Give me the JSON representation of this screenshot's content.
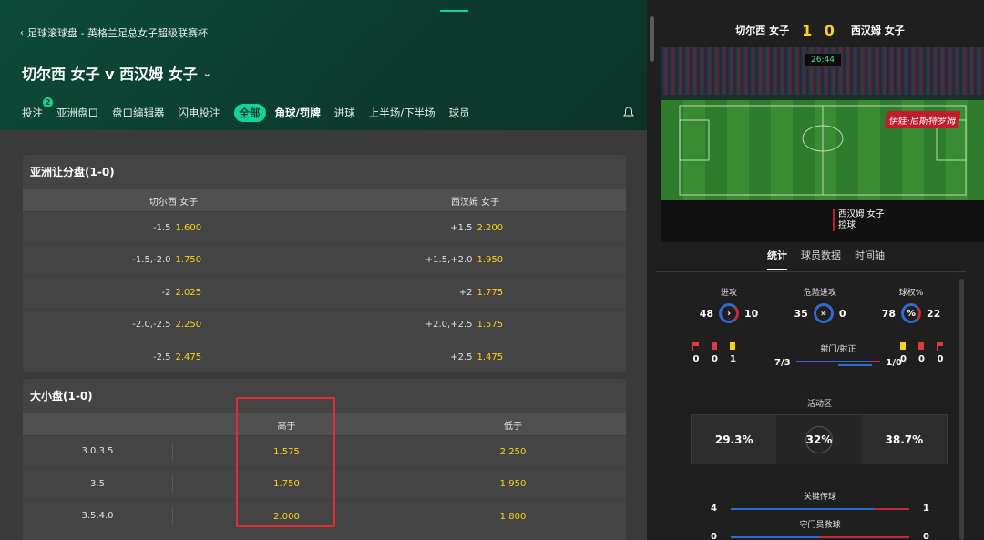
{
  "breadcrumb": {
    "label": "足球滚球盘 - 英格兰足总女子超级联赛杯"
  },
  "match": {
    "title": "切尔西 女子 v 西汉姆 女子",
    "home": "切尔西 女子",
    "away": "西汉姆 女子",
    "score": "1 0",
    "clock": "26:44"
  },
  "tabs": [
    {
      "label": "投注",
      "badge": "2"
    },
    {
      "label": "亚洲盘口"
    },
    {
      "label": "盘口编辑器"
    },
    {
      "label": "闪电投注"
    },
    {
      "label": "全部"
    },
    {
      "label": "角球/罚牌"
    },
    {
      "label": "进球"
    },
    {
      "label": "上半场/下半场"
    },
    {
      "label": "球员"
    }
  ],
  "asian_handicap": {
    "title": "亚洲让分盘(1-0)",
    "home_header": "切尔西 女子",
    "away_header": "西汉姆 女子",
    "rows": [
      {
        "home_line": "-1.5",
        "home_odds": "1.600",
        "away_line": "+1.5",
        "away_odds": "2.200"
      },
      {
        "home_line": "-1.5,-2.0",
        "home_odds": "1.750",
        "away_line": "+1.5,+2.0",
        "away_odds": "1.950"
      },
      {
        "home_line": "-2",
        "home_odds": "2.025",
        "away_line": "+2",
        "away_odds": "1.775"
      },
      {
        "home_line": "-2.0,-2.5",
        "home_odds": "2.250",
        "away_line": "+2.0,+2.5",
        "away_odds": "1.575"
      },
      {
        "home_line": "-2.5",
        "home_odds": "2.475",
        "away_line": "+2.5",
        "away_odds": "1.475"
      }
    ]
  },
  "over_under": {
    "title": "大小盘(1-0)",
    "over_header": "高于",
    "under_header": "低于",
    "rows": [
      {
        "line": "3.0,3.5",
        "over": "1.575",
        "under": "2.250"
      },
      {
        "line": "3.5",
        "over": "1.750",
        "under": "1.950"
      },
      {
        "line": "3.5,4.0",
        "over": "2.000",
        "under": "1.800"
      }
    ]
  },
  "pitch": {
    "player_tag": "伊娃·尼斯特罗姆",
    "possession_team": "西汉姆 女子",
    "possession_label": "控球"
  },
  "stat_tabs": [
    "统计",
    "球员数据",
    "时间轴"
  ],
  "stats": {
    "attacks": {
      "label": "进攻",
      "home": "48",
      "away": "10"
    },
    "dangerous": {
      "label": "危险进攻",
      "home": "35",
      "away": "0"
    },
    "possession": {
      "label": "球权%",
      "home": "78",
      "away": "22"
    },
    "home_cards": {
      "corners": "0",
      "red": "0",
      "yellow": "1"
    },
    "away_cards": {
      "yellow": "0",
      "red": "0",
      "corners": "0"
    },
    "shots": {
      "label": "射门/射正",
      "home": "7/3",
      "away": "1/0"
    },
    "zone": {
      "label": "活动区",
      "left": "29.3%",
      "mid": "32%",
      "right": "38.7%"
    },
    "key_passes": {
      "label": "关键传球",
      "home": "4",
      "away": "1",
      "home_frac": 0.8
    },
    "saves": {
      "label": "守门员救球",
      "home": "0",
      "away": "0",
      "home_frac": 0.5
    }
  },
  "colors": {
    "accent": "#14d29b",
    "odds": "#ffd21a",
    "home": "#2f6ad4",
    "away": "#c42b3a",
    "highlight": "#e52b2b"
  }
}
